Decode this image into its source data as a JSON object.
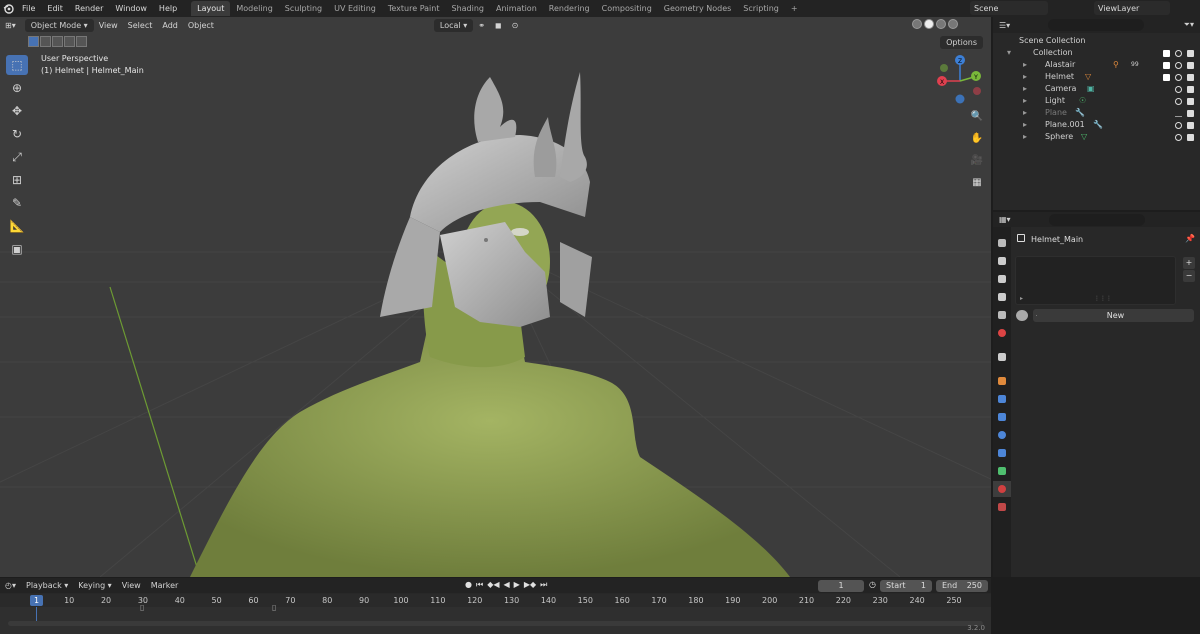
{
  "topbar": {
    "menus": [
      "File",
      "Edit",
      "Render",
      "Window",
      "Help"
    ],
    "tabs": [
      "Layout",
      "Modeling",
      "Sculpting",
      "UV Editing",
      "Texture Paint",
      "Shading",
      "Animation",
      "Rendering",
      "Compositing",
      "Geometry Nodes",
      "Scripting"
    ],
    "active_tab": "Layout",
    "add_tab": "+",
    "scene": "Scene",
    "view_layer": "ViewLayer"
  },
  "viewport": {
    "mode": "Object Mode",
    "menus": [
      "View",
      "Select",
      "Add",
      "Object"
    ],
    "orientation": "Local",
    "options": "Options",
    "perspective": "User Perspective",
    "active_object": "(1) Helmet | Helmet_Main",
    "gizmo": {
      "x": "X",
      "y": "Y",
      "z": "Z"
    },
    "tools": [
      "select-box",
      "cursor",
      "move",
      "rotate",
      "scale",
      "transform",
      "annotate",
      "measure",
      "add-cube"
    ]
  },
  "outliner": {
    "root": "Scene Collection",
    "collection": "Collection",
    "items": [
      {
        "name": "Alastair",
        "extra": "99",
        "dim": false
      },
      {
        "name": "Helmet",
        "extra": "",
        "dim": false
      },
      {
        "name": "Camera",
        "extra": "",
        "dim": false
      },
      {
        "name": "Light",
        "extra": "",
        "dim": false
      },
      {
        "name": "Plane",
        "extra": "",
        "dim": true
      },
      {
        "name": "Plane.001",
        "extra": "",
        "dim": false
      },
      {
        "name": "Sphere",
        "extra": "",
        "dim": false
      }
    ]
  },
  "properties": {
    "material_object": "Helmet_Main",
    "new_button": "New",
    "plus": "+",
    "minus": "−"
  },
  "timeline": {
    "menus": [
      "Playback",
      "Keying",
      "View",
      "Marker"
    ],
    "current_frame": "1",
    "start_label": "Start",
    "start": "1",
    "end_label": "End",
    "end": "250",
    "ticks": [
      "1",
      "10",
      "20",
      "30",
      "40",
      "50",
      "60",
      "70",
      "80",
      "90",
      "100",
      "110",
      "120",
      "130",
      "140",
      "150",
      "160",
      "170",
      "180",
      "190",
      "200",
      "210",
      "220",
      "230",
      "240",
      "250"
    ],
    "version": "3.2.0"
  },
  "colors": {
    "accent": "#4772b3",
    "skin": "#8fa155",
    "helmet": "#b4b4b4",
    "axis_x": "#e0404f",
    "axis_y": "#7ab83a",
    "axis_z": "#3c7fd6"
  }
}
